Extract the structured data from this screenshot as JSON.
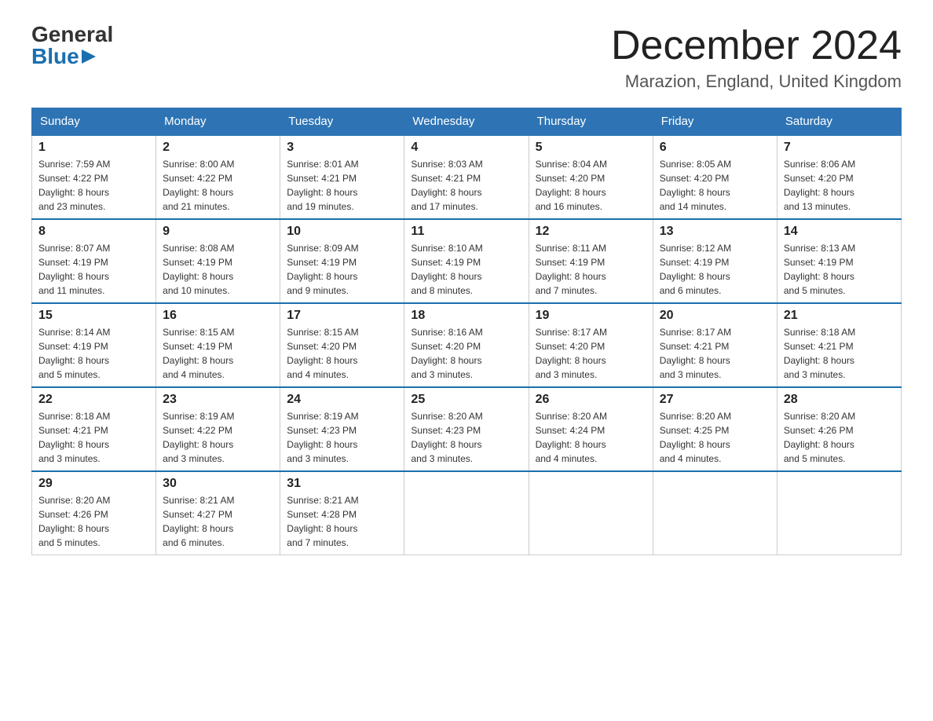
{
  "logo": {
    "general": "General",
    "blue": "Blue"
  },
  "title": "December 2024",
  "location": "Marazion, England, United Kingdom",
  "days_of_week": [
    "Sunday",
    "Monday",
    "Tuesday",
    "Wednesday",
    "Thursday",
    "Friday",
    "Saturday"
  ],
  "weeks": [
    [
      {
        "day": "1",
        "sunrise": "7:59 AM",
        "sunset": "4:22 PM",
        "daylight": "8 hours and 23 minutes."
      },
      {
        "day": "2",
        "sunrise": "8:00 AM",
        "sunset": "4:22 PM",
        "daylight": "8 hours and 21 minutes."
      },
      {
        "day": "3",
        "sunrise": "8:01 AM",
        "sunset": "4:21 PM",
        "daylight": "8 hours and 19 minutes."
      },
      {
        "day": "4",
        "sunrise": "8:03 AM",
        "sunset": "4:21 PM",
        "daylight": "8 hours and 17 minutes."
      },
      {
        "day": "5",
        "sunrise": "8:04 AM",
        "sunset": "4:20 PM",
        "daylight": "8 hours and 16 minutes."
      },
      {
        "day": "6",
        "sunrise": "8:05 AM",
        "sunset": "4:20 PM",
        "daylight": "8 hours and 14 minutes."
      },
      {
        "day": "7",
        "sunrise": "8:06 AM",
        "sunset": "4:20 PM",
        "daylight": "8 hours and 13 minutes."
      }
    ],
    [
      {
        "day": "8",
        "sunrise": "8:07 AM",
        "sunset": "4:19 PM",
        "daylight": "8 hours and 11 minutes."
      },
      {
        "day": "9",
        "sunrise": "8:08 AM",
        "sunset": "4:19 PM",
        "daylight": "8 hours and 10 minutes."
      },
      {
        "day": "10",
        "sunrise": "8:09 AM",
        "sunset": "4:19 PM",
        "daylight": "8 hours and 9 minutes."
      },
      {
        "day": "11",
        "sunrise": "8:10 AM",
        "sunset": "4:19 PM",
        "daylight": "8 hours and 8 minutes."
      },
      {
        "day": "12",
        "sunrise": "8:11 AM",
        "sunset": "4:19 PM",
        "daylight": "8 hours and 7 minutes."
      },
      {
        "day": "13",
        "sunrise": "8:12 AM",
        "sunset": "4:19 PM",
        "daylight": "8 hours and 6 minutes."
      },
      {
        "day": "14",
        "sunrise": "8:13 AM",
        "sunset": "4:19 PM",
        "daylight": "8 hours and 5 minutes."
      }
    ],
    [
      {
        "day": "15",
        "sunrise": "8:14 AM",
        "sunset": "4:19 PM",
        "daylight": "8 hours and 5 minutes."
      },
      {
        "day": "16",
        "sunrise": "8:15 AM",
        "sunset": "4:19 PM",
        "daylight": "8 hours and 4 minutes."
      },
      {
        "day": "17",
        "sunrise": "8:15 AM",
        "sunset": "4:20 PM",
        "daylight": "8 hours and 4 minutes."
      },
      {
        "day": "18",
        "sunrise": "8:16 AM",
        "sunset": "4:20 PM",
        "daylight": "8 hours and 3 minutes."
      },
      {
        "day": "19",
        "sunrise": "8:17 AM",
        "sunset": "4:20 PM",
        "daylight": "8 hours and 3 minutes."
      },
      {
        "day": "20",
        "sunrise": "8:17 AM",
        "sunset": "4:21 PM",
        "daylight": "8 hours and 3 minutes."
      },
      {
        "day": "21",
        "sunrise": "8:18 AM",
        "sunset": "4:21 PM",
        "daylight": "8 hours and 3 minutes."
      }
    ],
    [
      {
        "day": "22",
        "sunrise": "8:18 AM",
        "sunset": "4:21 PM",
        "daylight": "8 hours and 3 minutes."
      },
      {
        "day": "23",
        "sunrise": "8:19 AM",
        "sunset": "4:22 PM",
        "daylight": "8 hours and 3 minutes."
      },
      {
        "day": "24",
        "sunrise": "8:19 AM",
        "sunset": "4:23 PM",
        "daylight": "8 hours and 3 minutes."
      },
      {
        "day": "25",
        "sunrise": "8:20 AM",
        "sunset": "4:23 PM",
        "daylight": "8 hours and 3 minutes."
      },
      {
        "day": "26",
        "sunrise": "8:20 AM",
        "sunset": "4:24 PM",
        "daylight": "8 hours and 4 minutes."
      },
      {
        "day": "27",
        "sunrise": "8:20 AM",
        "sunset": "4:25 PM",
        "daylight": "8 hours and 4 minutes."
      },
      {
        "day": "28",
        "sunrise": "8:20 AM",
        "sunset": "4:26 PM",
        "daylight": "8 hours and 5 minutes."
      }
    ],
    [
      {
        "day": "29",
        "sunrise": "8:20 AM",
        "sunset": "4:26 PM",
        "daylight": "8 hours and 5 minutes."
      },
      {
        "day": "30",
        "sunrise": "8:21 AM",
        "sunset": "4:27 PM",
        "daylight": "8 hours and 6 minutes."
      },
      {
        "day": "31",
        "sunrise": "8:21 AM",
        "sunset": "4:28 PM",
        "daylight": "8 hours and 7 minutes."
      },
      null,
      null,
      null,
      null
    ]
  ],
  "labels": {
    "sunrise": "Sunrise:",
    "sunset": "Sunset:",
    "daylight": "Daylight:"
  }
}
